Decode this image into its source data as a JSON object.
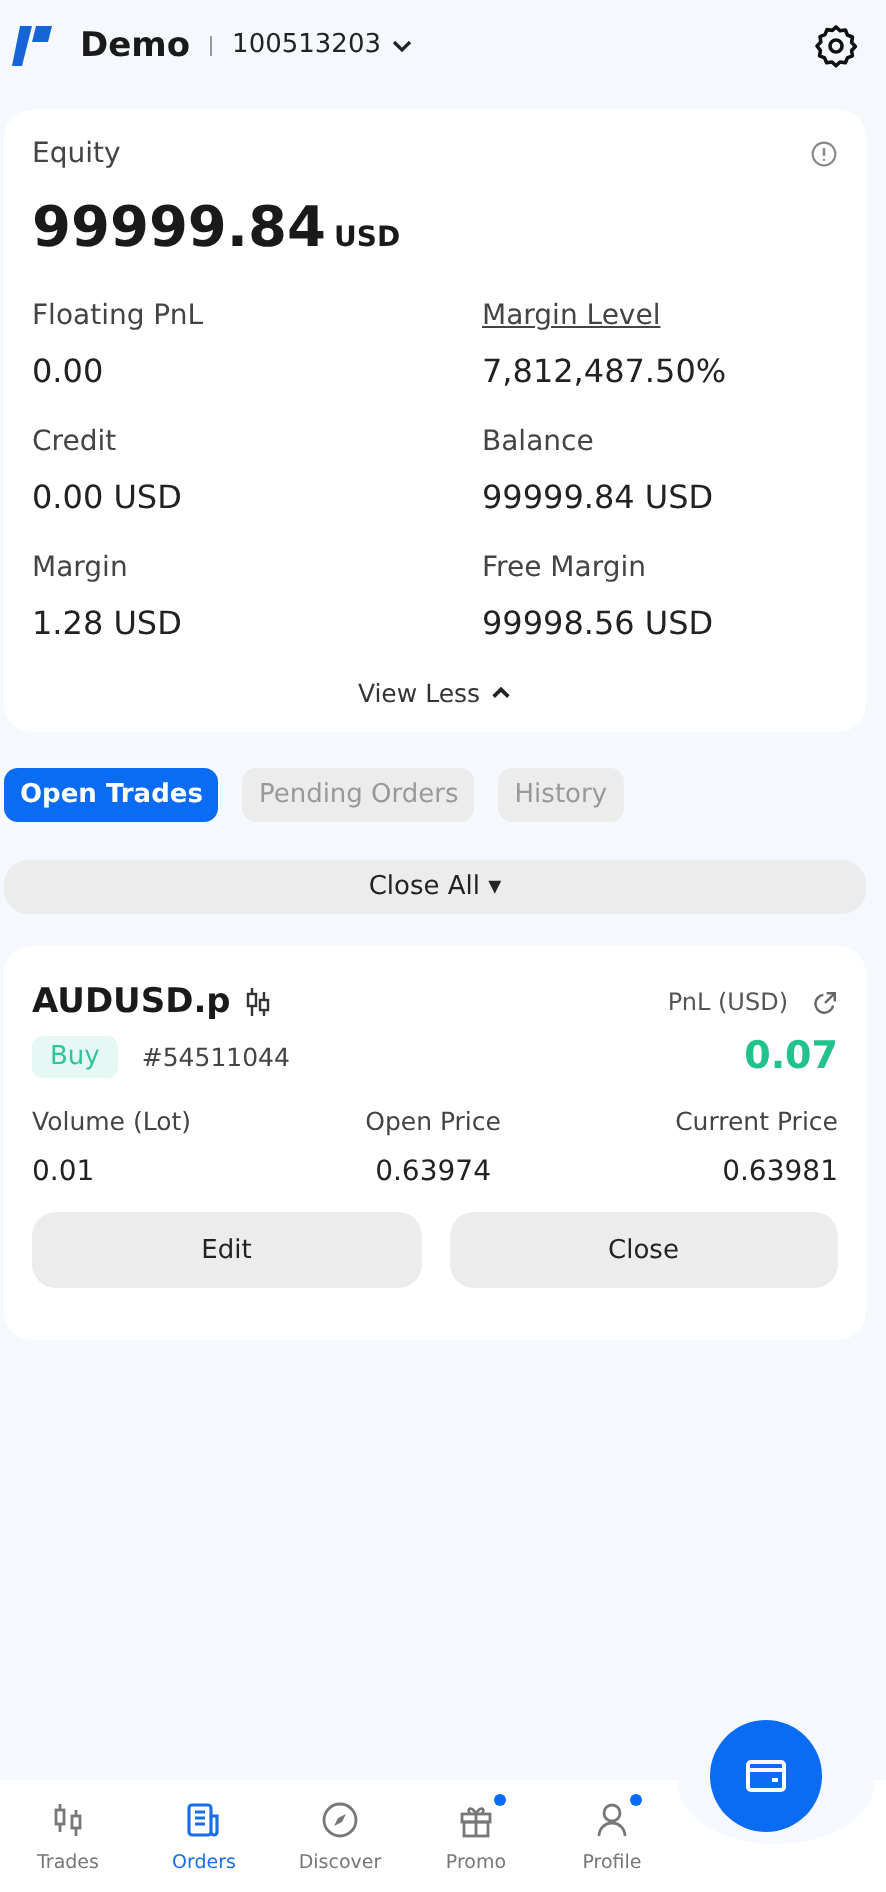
{
  "header": {
    "account_type": "Demo",
    "account_number": "100513203"
  },
  "summary": {
    "equity_label": "Equity",
    "equity_value": "99999.84",
    "equity_currency": "USD",
    "stats": [
      {
        "label": "Floating PnL",
        "value": "0.00",
        "underlined": false
      },
      {
        "label": "Margin Level",
        "value": "7,812,487.50%",
        "underlined": true
      },
      {
        "label": "Credit",
        "value": "0.00 USD",
        "underlined": false
      },
      {
        "label": "Balance",
        "value": "99999.84 USD",
        "underlined": false
      },
      {
        "label": "Margin",
        "value": "1.28 USD",
        "underlined": false
      },
      {
        "label": "Free Margin",
        "value": "99998.56 USD",
        "underlined": false
      }
    ],
    "toggle": "View Less"
  },
  "tabs": [
    {
      "label": "Open Trades",
      "selected": true
    },
    {
      "label": "Pending Orders",
      "selected": false
    },
    {
      "label": "History",
      "selected": false
    }
  ],
  "close_all": "Close All ▾",
  "trades": [
    {
      "symbol": "AUDUSD.p",
      "side": "Buy",
      "ticket": "#54511044",
      "pnl_label": "PnL (USD)",
      "pnl": "0.07",
      "fields": [
        {
          "label": "Volume (Lot)",
          "value": "0.01"
        },
        {
          "label": "Open Price",
          "value": "0.63974"
        },
        {
          "label": "Current Price",
          "value": "0.63981"
        }
      ],
      "buttons": [
        "Edit",
        "Close"
      ]
    }
  ],
  "nav": [
    {
      "label": "Trades",
      "selected": false,
      "badge": false
    },
    {
      "label": "Orders",
      "selected": true,
      "badge": false
    },
    {
      "label": "Discover",
      "selected": false,
      "badge": false
    },
    {
      "label": "Promo",
      "selected": false,
      "badge": true
    },
    {
      "label": "Profile",
      "selected": false,
      "badge": true
    }
  ]
}
